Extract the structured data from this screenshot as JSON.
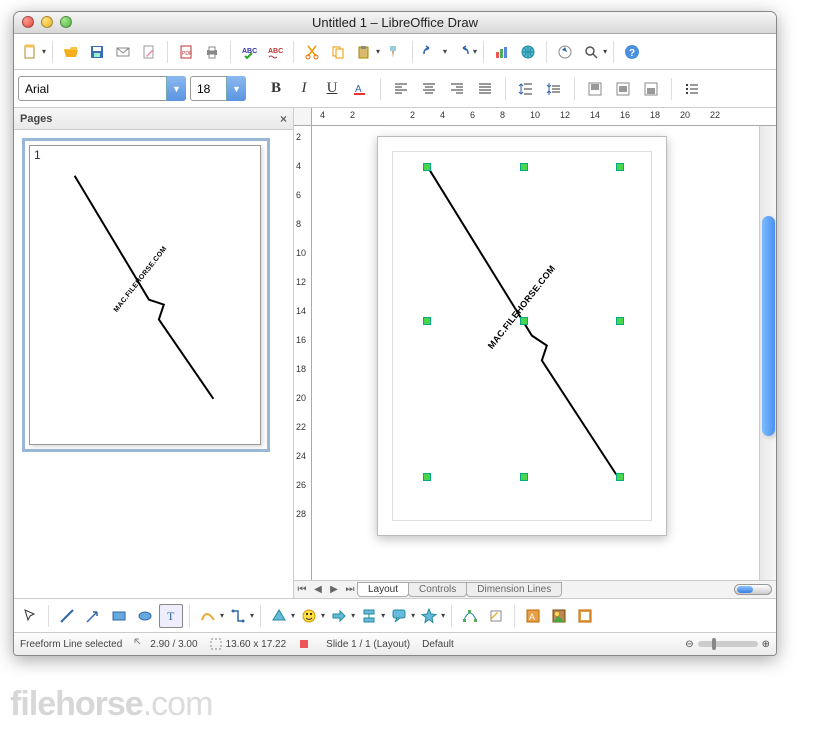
{
  "window": {
    "title": "Untitled 1 – LibreOffice Draw"
  },
  "format": {
    "font": "Arial",
    "size": "18"
  },
  "pages_panel": {
    "title": "Pages",
    "thumb_number": "1"
  },
  "ruler_h": [
    "4",
    "2",
    "",
    "2",
    "4",
    "6",
    "8",
    "10",
    "12",
    "14",
    "16",
    "18",
    "20",
    "22"
  ],
  "ruler_v": [
    "2",
    "4",
    "6",
    "8",
    "10",
    "12",
    "14",
    "16",
    "18",
    "20",
    "22",
    "24",
    "26",
    "28"
  ],
  "tabs": {
    "layout": "Layout",
    "controls": "Controls",
    "dimension": "Dimension Lines"
  },
  "status": {
    "selection": "Freeform Line selected",
    "pos": "2.90 / 3.00",
    "size": "13.60 x 17.22",
    "slide": "Slide 1 / 1 (Layout)",
    "style": "Default"
  },
  "canvas_watermark": "MAC.FILEHORSE.COM",
  "site_watermark_main": "filehorse",
  "site_watermark_suffix": ".com"
}
